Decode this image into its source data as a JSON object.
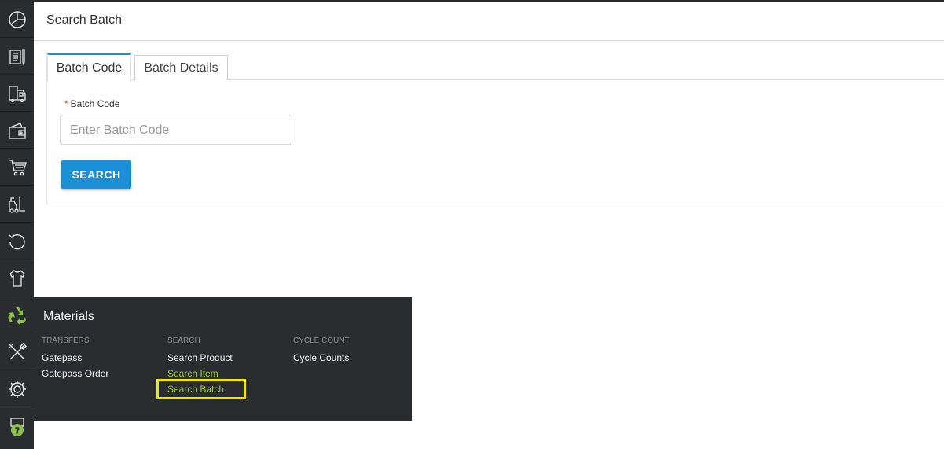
{
  "header": {
    "title": "Search Batch"
  },
  "tabs": [
    {
      "label": "Batch Code",
      "active": true
    },
    {
      "label": "Batch Details",
      "active": false
    }
  ],
  "form": {
    "required_mark": "*",
    "batch_code_label": "Batch Code",
    "batch_code_placeholder": "Enter Batch Code",
    "batch_code_value": "",
    "search_button": "SEARCH"
  },
  "rail": {
    "items": [
      {
        "icon": "dashboard-icon"
      },
      {
        "icon": "orders-icon"
      },
      {
        "icon": "shipping-icon"
      },
      {
        "icon": "wallet-icon"
      },
      {
        "icon": "cart-icon"
      },
      {
        "icon": "forklift-icon"
      },
      {
        "icon": "returns-icon"
      },
      {
        "icon": "apparel-icon"
      },
      {
        "icon": "materials-recycle-icon",
        "active": true
      },
      {
        "icon": "tools-icon"
      },
      {
        "icon": "settings-gear-icon"
      },
      {
        "icon": "help-icon"
      }
    ]
  },
  "flyout": {
    "title": "Materials",
    "columns": [
      {
        "heading": "TRANSFERS",
        "items": [
          "Gatepass",
          "Gatepass Order"
        ]
      },
      {
        "heading": "SEARCH",
        "items": [
          "Search Product",
          "Search Item",
          "Search Batch"
        ]
      },
      {
        "heading": "CYCLE COUNT",
        "items": [
          "Cycle Counts"
        ]
      }
    ]
  },
  "colors": {
    "accent": "#1a8fd6",
    "rail_bg": "#2a2d2f",
    "menu_highlight_text": "#9ccc3c",
    "highlight_box": "#f2e600",
    "recycle_icon": "#8bc34a"
  }
}
